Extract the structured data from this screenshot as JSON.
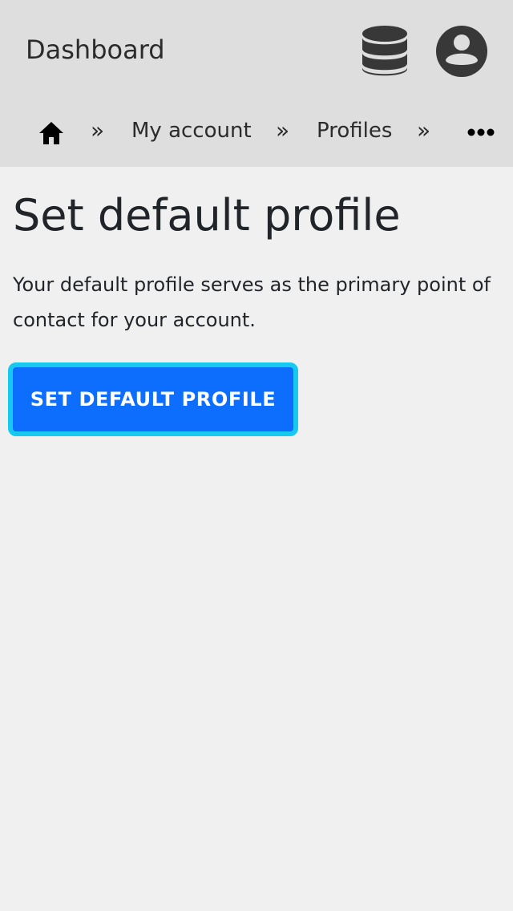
{
  "header": {
    "title": "Dashboard",
    "icons": {
      "database": "database-icon",
      "account": "user-circle-icon"
    }
  },
  "breadcrumb": {
    "home_icon": "home-icon",
    "separator": "»",
    "items": [
      {
        "label": "My account"
      },
      {
        "label": "Profiles"
      }
    ],
    "overflow_icon": "more-horizontal-icon"
  },
  "main": {
    "title": "Set default profile",
    "description": "Your default profile serves as the primary point of contact for your account.",
    "button_label": "SET DEFAULT PROFILE"
  },
  "colors": {
    "header_bg": "#dedede",
    "page_bg": "#f0f0f0",
    "button_bg": "#0d6efd",
    "button_focus_ring": "#17c9ee",
    "icon_dark": "#383838"
  }
}
